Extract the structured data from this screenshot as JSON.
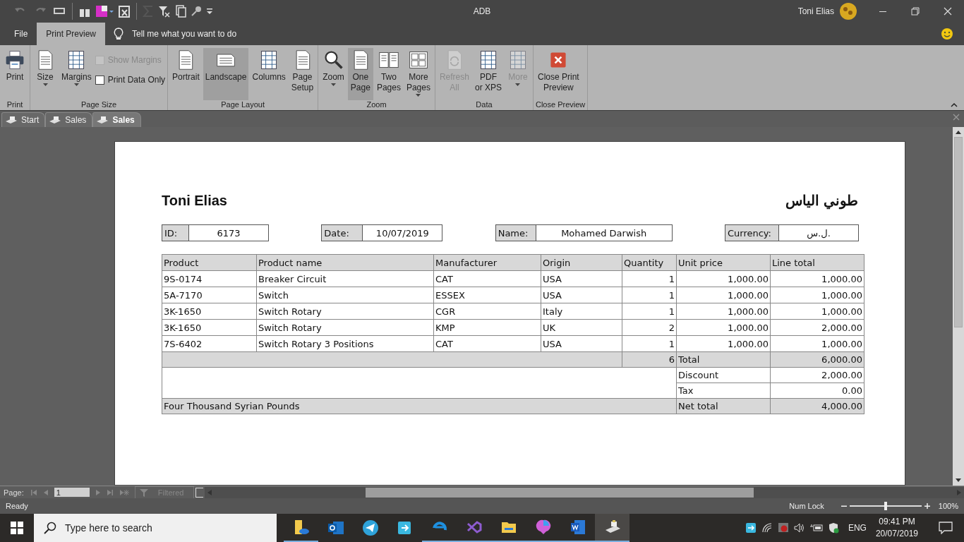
{
  "window": {
    "title": "ADB",
    "user": "Toni Elias"
  },
  "menu": [
    {
      "label": "File",
      "selected": false
    },
    {
      "label": "Print Preview",
      "selected": true
    }
  ],
  "tell_me": {
    "placeholder": "Tell me what you want to do"
  },
  "ribbon": [
    {
      "name": "Print",
      "buttons": [
        {
          "kind": "large",
          "lines": [
            "Print"
          ],
          "selected": false,
          "disabled": false,
          "has_menu": false
        }
      ]
    },
    {
      "name": "Page Size",
      "buttons": [
        {
          "kind": "large",
          "lines": [
            "Size"
          ],
          "selected": false,
          "disabled": false,
          "has_menu": true
        },
        {
          "kind": "large",
          "lines": [
            "Margins"
          ],
          "selected": false,
          "disabled": false,
          "has_menu": true
        },
        {
          "kind": "checks",
          "items": [
            {
              "label": "Show Margins",
              "checked": false,
              "disabled": true
            },
            {
              "label": "Print Data Only",
              "checked": false,
              "disabled": false
            }
          ]
        }
      ]
    },
    {
      "name": "Page Layout",
      "buttons": [
        {
          "kind": "large",
          "lines": [
            "Portrait"
          ],
          "selected": false,
          "disabled": false,
          "has_menu": false
        },
        {
          "kind": "large",
          "lines": [
            "Landscape"
          ],
          "selected": true,
          "disabled": false,
          "has_menu": false
        },
        {
          "kind": "large",
          "lines": [
            "Columns"
          ],
          "selected": false,
          "disabled": false,
          "has_menu": false
        },
        {
          "kind": "large",
          "lines": [
            "Page",
            "Setup"
          ],
          "selected": false,
          "disabled": false,
          "has_menu": false
        }
      ]
    },
    {
      "name": "Zoom",
      "buttons": [
        {
          "kind": "large",
          "lines": [
            "Zoom"
          ],
          "selected": false,
          "disabled": false,
          "has_menu": true
        },
        {
          "kind": "large",
          "lines": [
            "One",
            "Page"
          ],
          "selected": true,
          "disabled": false,
          "has_menu": false
        },
        {
          "kind": "large",
          "lines": [
            "Two",
            "Pages"
          ],
          "selected": false,
          "disabled": false,
          "has_menu": false
        },
        {
          "kind": "large",
          "lines": [
            "More",
            "Pages"
          ],
          "selected": false,
          "disabled": false,
          "has_menu": true
        }
      ]
    },
    {
      "name": "Data",
      "buttons": [
        {
          "kind": "large",
          "lines": [
            "Refresh",
            "All"
          ],
          "selected": false,
          "disabled": true,
          "has_menu": false
        },
        {
          "kind": "large",
          "lines": [
            "PDF",
            "or XPS"
          ],
          "selected": false,
          "disabled": false,
          "has_menu": false
        },
        {
          "kind": "large",
          "lines": [
            "More"
          ],
          "selected": false,
          "disabled": true,
          "has_menu": true
        }
      ]
    },
    {
      "name": "Close Preview",
      "buttons": [
        {
          "kind": "large",
          "lines": [
            "Close Print",
            "Preview"
          ],
          "selected": false,
          "disabled": false,
          "has_menu": false
        }
      ]
    }
  ],
  "doc_tabs": [
    {
      "label": "Start",
      "selected": false
    },
    {
      "label": "Sales",
      "selected": false
    },
    {
      "label": "Sales",
      "selected": true
    }
  ],
  "report": {
    "title": "Toni Elias",
    "title_arabic": "طوني الياس",
    "fields": [
      {
        "label": "ID:",
        "value": "6173"
      },
      {
        "label": "Date:",
        "value": "10/07/2019"
      },
      {
        "label": "Name:",
        "value": "Mohamed Darwish"
      },
      {
        "label": "Currency:",
        "value": "ل.س."
      }
    ],
    "columns": [
      "Product",
      "Product name",
      "Manufacturer",
      "Origin",
      "Quantity",
      "Unit price",
      "Line total"
    ],
    "rows": [
      [
        "9S-0174",
        "Breaker Circuit",
        "CAT",
        "USA",
        "1",
        "1,000.00",
        "1,000.00"
      ],
      [
        "5A-7170",
        "Switch",
        "ESSEX",
        "USA",
        "1",
        "1,000.00",
        "1,000.00"
      ],
      [
        "3K-1650",
        "Switch Rotary",
        "CGR",
        "Italy",
        "1",
        "1,000.00",
        "1,000.00"
      ],
      [
        "3K-1650",
        "Switch Rotary",
        "KMP",
        "UK",
        "2",
        "1,000.00",
        "2,000.00"
      ],
      [
        "7S-6402",
        "Switch Rotary 3 Positions",
        "CAT",
        "USA",
        "1",
        "1,000.00",
        "1,000.00"
      ]
    ],
    "total_quantity": "6",
    "total_label": "Total",
    "total": "6,000.00",
    "discount_label": "Discount",
    "discount": "2,000.00",
    "tax_label": "Tax",
    "tax": "0.00",
    "amount_in_words": "Four Thousand Syrian Pounds",
    "net_total_label": "Net total",
    "net_total": "4,000.00"
  },
  "record_nav": {
    "label": "Page:",
    "value": "1",
    "filter": "Filtered"
  },
  "status_bar": {
    "status": "Ready",
    "num_lock": "Num Lock",
    "zoom": {
      "level": 0.5,
      "reading": "100%"
    }
  },
  "taskbar": {
    "search": {
      "placeholder": "Type here to search"
    },
    "language": "ENG",
    "time": "09:41 PM",
    "date": "20/07/2019"
  }
}
